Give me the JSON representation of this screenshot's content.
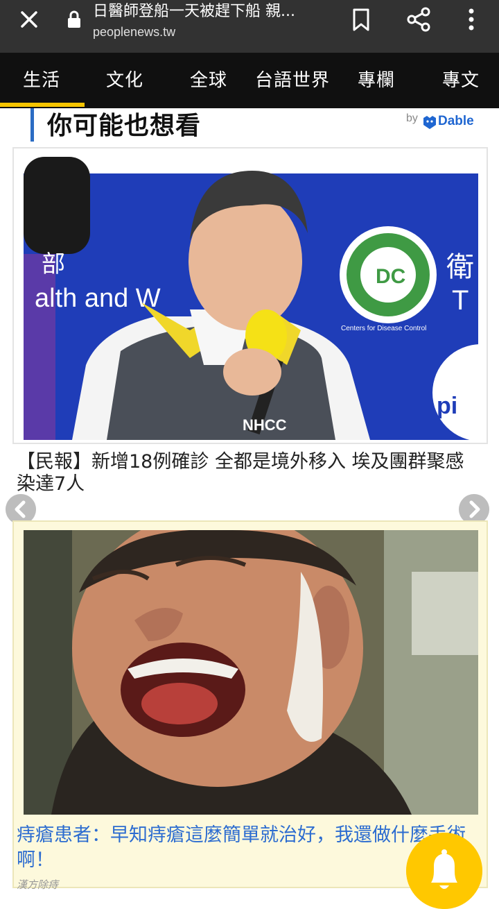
{
  "browser": {
    "page_title": "日醫師登船一天被趕下船 親...",
    "url": "peoplenews.tw",
    "icons": [
      "close-icon",
      "lock-icon",
      "bookmark-icon",
      "share-icon",
      "more-icon"
    ]
  },
  "nav": {
    "tabs": [
      {
        "label": "生活",
        "active": true
      },
      {
        "label": "文化"
      },
      {
        "label": "全球"
      },
      {
        "label": "台語世界"
      },
      {
        "label": "專欄"
      },
      {
        "label": "專文"
      }
    ],
    "active_color": "#f5c400"
  },
  "section": {
    "heading": "你可能也想看",
    "by_label": "by",
    "provider": "Dable",
    "accent_color": "#2b6cc4"
  },
  "articles": [
    {
      "title": "【民報】新增18例確診 全都是境外移入 埃及團群聚感染達7人",
      "image_text": {
        "wall_text_1": "部",
        "wall_text_2": "alth and W",
        "wall_text_3": "衛",
        "wall_text_4": "T",
        "wall_text_5": "pi",
        "logo_text": "Centers for Disease Control",
        "vest_text": "NHCC"
      }
    },
    {
      "title": "痔瘡患者：早知痔瘡這麼簡單就治好，我還做什麼手術啊！",
      "source": "漢方除痔",
      "sponsored_bg": "#fdf9dc",
      "title_color": "#2c6cd0"
    }
  ],
  "carousel": {
    "prev_icon": "chevron-left-icon",
    "next_icon": "chevron-right-icon"
  },
  "notification": {
    "icon": "bell-icon",
    "color": "#ffc800"
  }
}
